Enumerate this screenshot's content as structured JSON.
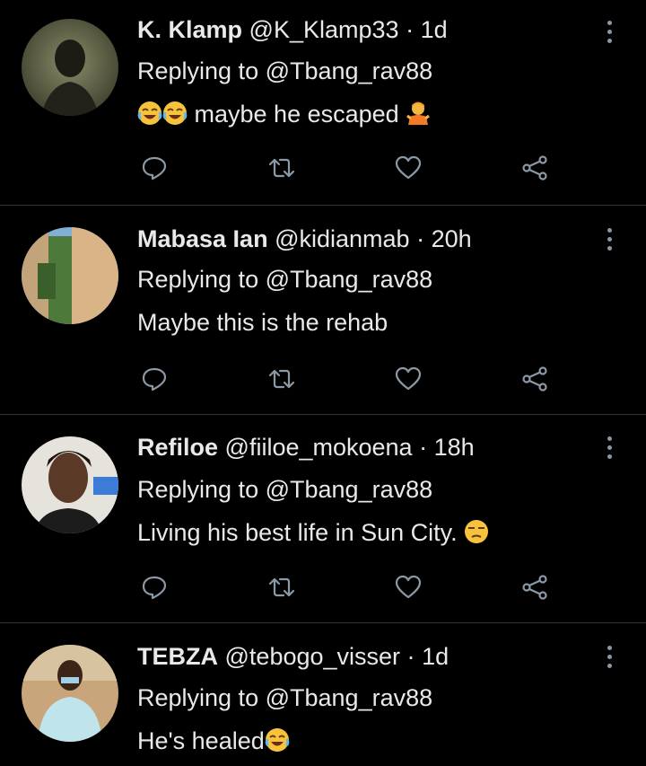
{
  "tweets": [
    {
      "display_name": "K. Klamp",
      "handle": "@K_Klamp33",
      "time": "1d",
      "replying_prefix": "Replying to",
      "replying_handle": "@Tbang_rav88",
      "text": "maybe he escaped",
      "emojis_before": [
        "joy-emoji",
        "joy-emoji"
      ],
      "emojis_after": [
        "person-shrugging-emoji"
      ]
    },
    {
      "display_name": "Mabasa Ian",
      "handle": "@kidianmab",
      "time": "20h",
      "replying_prefix": "Replying to",
      "replying_handle": "@Tbang_rav88",
      "text": "Maybe this is the rehab"
    },
    {
      "display_name": "Refiloe",
      "handle": "@fiiloe_mokoena",
      "time": "18h",
      "replying_prefix": "Replying to",
      "replying_handle": "@Tbang_rav88",
      "text": "Living his best life in Sun City.",
      "emojis_after": [
        "unamused-face-emoji"
      ]
    },
    {
      "display_name": "TEBZA",
      "handle": "@tebogo_visser",
      "time": "1d",
      "replying_prefix": "Replying to",
      "replying_handle": "@Tbang_rav88",
      "text": "He's healed",
      "emojis_after": [
        "joy-emoji"
      ]
    }
  ],
  "separator": "·",
  "icons": {
    "reply": "reply-icon",
    "retweet": "retweet-icon",
    "like": "heart-icon",
    "share": "share-icon",
    "more": "more-vertical-icon"
  },
  "colors": {
    "background": "#000000",
    "text": "#e7e9ea",
    "icon": "#8b98a5",
    "divider": "#2f3336"
  }
}
